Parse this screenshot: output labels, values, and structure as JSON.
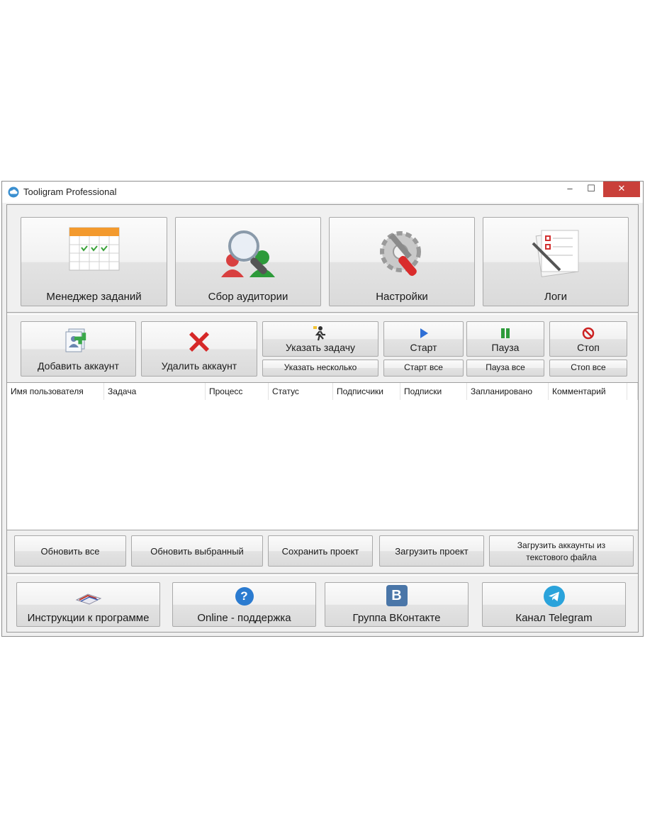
{
  "window": {
    "title": "Tooligram Professional",
    "minimize": "‒",
    "maximize": "☐",
    "close": "✕"
  },
  "main_menu": [
    {
      "label": "Менеджер заданий",
      "icon": "calendar-icon"
    },
    {
      "label": "Сбор аудитории",
      "icon": "audience-search-icon"
    },
    {
      "label": "Настройки",
      "icon": "settings-tools-icon"
    },
    {
      "label": "Логи",
      "icon": "log-notes-icon"
    }
  ],
  "accounts": {
    "add": "Добавить аккаунт",
    "remove": "Удалить аккаунт"
  },
  "task": {
    "set": "Указать задачу",
    "set_multi": "Указать несколько"
  },
  "control": {
    "start": "Старт",
    "start_all": "Старт все",
    "pause": "Пауза",
    "pause_all": "Пауза все",
    "stop": "Стоп",
    "stop_all": "Стоп все"
  },
  "table": {
    "columns": [
      "Имя пользователя",
      "Задача",
      "Процесс",
      "Статус",
      "Подписчики",
      "Подписки",
      "Запланировано",
      "Комментарий"
    ]
  },
  "actions": {
    "refresh_all": "Обновить все",
    "refresh_selected": "Обновить выбранный",
    "save_project": "Сохранить проект",
    "load_project": "Загрузить проект",
    "load_accounts_line1": "Загрузить аккаунты из",
    "load_accounts_line2": "текстового файла"
  },
  "links": [
    {
      "label": "Инструкции к программе",
      "icon": "book-icon"
    },
    {
      "label": "Online - поддержка",
      "icon": "help-icon",
      "glyph": "?"
    },
    {
      "label": "Группа ВКонтакте",
      "icon": "vk-icon",
      "glyph": "B"
    },
    {
      "label": "Канал Telegram",
      "icon": "telegram-icon"
    }
  ],
  "colors": {
    "close": "#c9403a",
    "start": "#2f6fd6",
    "pause": "#2e9b3b",
    "stop": "#cc2222",
    "help": "#2b7bd0",
    "vk": "#4a76a8",
    "telegram": "#2aa3db"
  }
}
